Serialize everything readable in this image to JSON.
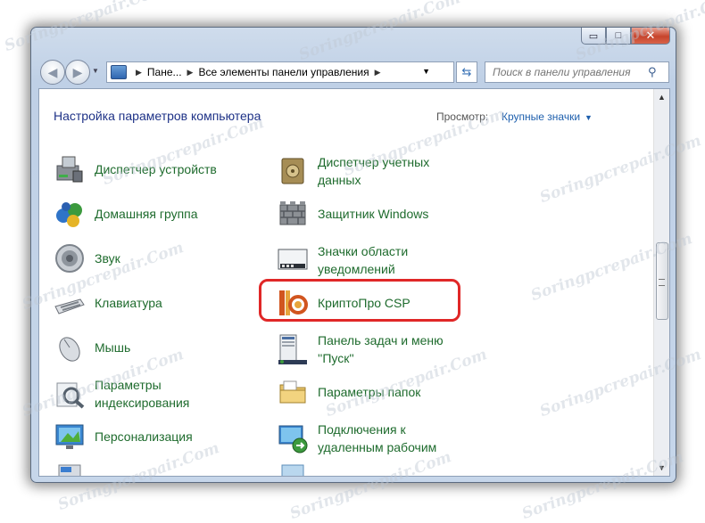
{
  "window": {
    "controls": {
      "minimize": "▭",
      "maximize": "□",
      "close": "✕"
    }
  },
  "nav": {
    "breadcrumb": [
      "Пане...",
      "Все элементы панели управления"
    ],
    "search_placeholder": "Поиск в панели управления"
  },
  "header": {
    "title": "Настройка параметров компьютера",
    "view_label": "Просмотр:",
    "view_value": "Крупные значки"
  },
  "items_left": [
    {
      "label": "Диспетчер устройств",
      "icon": "device-manager-icon"
    },
    {
      "label": "Домашняя группа",
      "icon": "homegroup-icon"
    },
    {
      "label": "Звук",
      "icon": "speaker-icon"
    },
    {
      "label": "Клавиатура",
      "icon": "keyboard-icon"
    },
    {
      "label": "Мышь",
      "icon": "mouse-icon"
    },
    {
      "label": "Параметры индексирования",
      "icon": "indexing-icon"
    },
    {
      "label": "Персонализация",
      "icon": "personalization-icon"
    }
  ],
  "items_right": [
    {
      "label": "Диспетчер учетных данных",
      "icon": "credential-vault-icon"
    },
    {
      "label": "Защитник Windows",
      "icon": "defender-wall-icon"
    },
    {
      "label": "Значки области уведомлений",
      "icon": "notification-area-icon"
    },
    {
      "label": "КриптоПро CSP",
      "icon": "cryptopro-icon"
    },
    {
      "label": "Панель задач и меню ''Пуск''",
      "icon": "taskbar-icon"
    },
    {
      "label": "Параметры папок",
      "icon": "folder-options-icon"
    },
    {
      "label": "Подключения к удаленным рабочим",
      "icon": "remote-connections-icon"
    }
  ],
  "watermark": "Soringpcrepair.Com",
  "colors": {
    "link": "#1e6b2d",
    "heading": "#1e3287",
    "highlight": "#e02727"
  }
}
